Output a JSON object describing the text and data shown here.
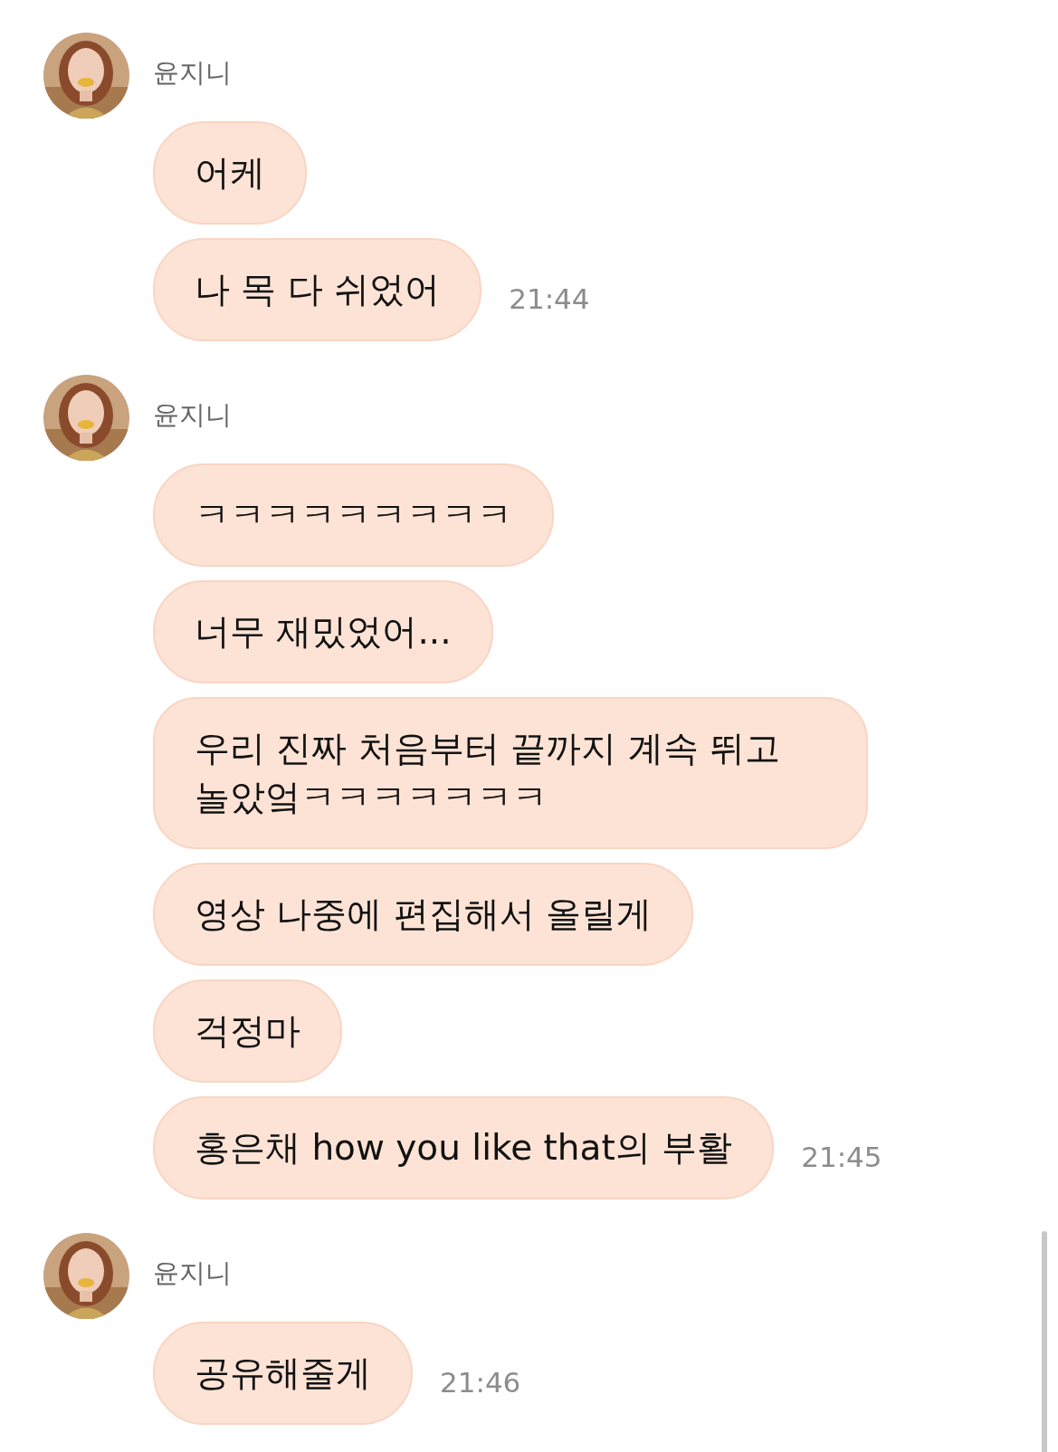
{
  "groups": [
    {
      "sender": "윤지니",
      "messages": [
        {
          "text": "어케"
        },
        {
          "text": "나 목 다 쉬었어",
          "time": "21:44"
        }
      ]
    },
    {
      "sender": "윤지니",
      "messages": [
        {
          "text": "ㅋㅋㅋㅋㅋㅋㅋㅋㅋ"
        },
        {
          "text": "너무 재밌었어..."
        },
        {
          "text": "우리 진짜 처음부터 끝까지 계속 뛰고 놀았엌ㅋㅋㅋㅋㅋㅋㅋ"
        },
        {
          "text": "영상 나중에 편집해서 올릴게"
        },
        {
          "text": "걱정마"
        },
        {
          "text": "홍은채 how you like that의 부활",
          "time": "21:45"
        }
      ]
    },
    {
      "sender": "윤지니",
      "messages": [
        {
          "text": "공유해줄게",
          "time": "21:46"
        }
      ]
    }
  ]
}
